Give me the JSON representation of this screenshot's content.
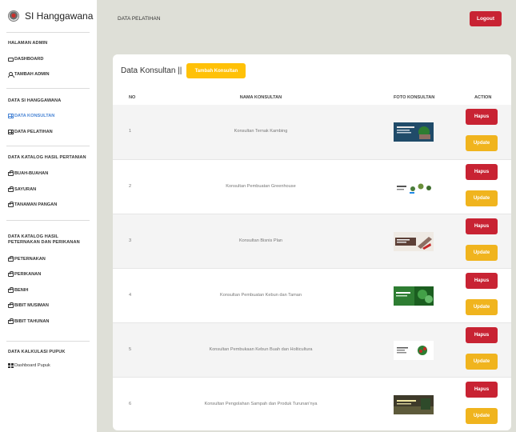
{
  "brand": {
    "name": "SI Hanggawana"
  },
  "sidebar": {
    "sections": [
      {
        "title": "HALAMAN ADMIN",
        "items": [
          {
            "label": "DASHBOARD",
            "icon": "monitor-icon"
          },
          {
            "label": "TAMBAH ADMIN",
            "icon": "users-icon"
          }
        ]
      },
      {
        "title": "DATA SI HANGGAWANA",
        "items": [
          {
            "label": "DATA KONSULTAN",
            "icon": "table-icon",
            "active": true
          },
          {
            "label": "DATA PELATIHAN",
            "icon": "table-icon"
          }
        ]
      },
      {
        "title": "DATA KATALOG HASIL PERTANIAN",
        "items": [
          {
            "label": "BUAH-BUAHAN",
            "icon": "bag-icon"
          },
          {
            "label": "SAYURAN",
            "icon": "bag-icon"
          },
          {
            "label": "TANAMAN PANGAN",
            "icon": "bag-icon"
          }
        ]
      },
      {
        "title": "DATA KATALOG HASIL PETERNAKAN DAN PERIKANAN",
        "items": [
          {
            "label": "PETERNAKAN",
            "icon": "bag-icon"
          },
          {
            "label": "PERIKANAN",
            "icon": "bag-icon"
          },
          {
            "label": "BENIH",
            "icon": "bag-icon"
          },
          {
            "label": "BIBIT MUSIMAN",
            "icon": "bag-icon"
          },
          {
            "label": "BIBIT TAHUNAN",
            "icon": "bag-icon"
          }
        ]
      },
      {
        "title": "DATA KALKULASI PUPUK",
        "items": [
          {
            "label": "Dashboard Pupuk",
            "icon": "dashboard-icon"
          }
        ]
      }
    ]
  },
  "topbar": {
    "title": "DATA PELATIHAN",
    "logout_label": "Logout"
  },
  "card": {
    "title": "Data Konsultan ||",
    "add_button": "Tambah Konsultan",
    "columns": {
      "no": "NO",
      "name": "NAMA KONSULTAN",
      "photo": "FOTO KONSULTAN",
      "action": "ACTION"
    },
    "delete_label": "Hapus",
    "update_label": "Update",
    "rows": [
      {
        "no": "1",
        "name": "Konsultan Ternak Kambing"
      },
      {
        "no": "2",
        "name": "Konsultan Pembuatan Greenhouse"
      },
      {
        "no": "3",
        "name": "Konsultan Bisnis Plan"
      },
      {
        "no": "4",
        "name": "Konsultan Pembuatan Kebun dan Taman"
      },
      {
        "no": "5",
        "name": "Konsultan Pembukaan Kebun Buah dan Holticultura"
      },
      {
        "no": "6",
        "name": "Konsultan Pengolahan Sampah dan Produk Turunan'nya"
      }
    ]
  },
  "colors": {
    "danger": "#c82333",
    "warning": "#ffc107",
    "active_link": "#4a86d6",
    "main_bg": "#dedfd7"
  }
}
